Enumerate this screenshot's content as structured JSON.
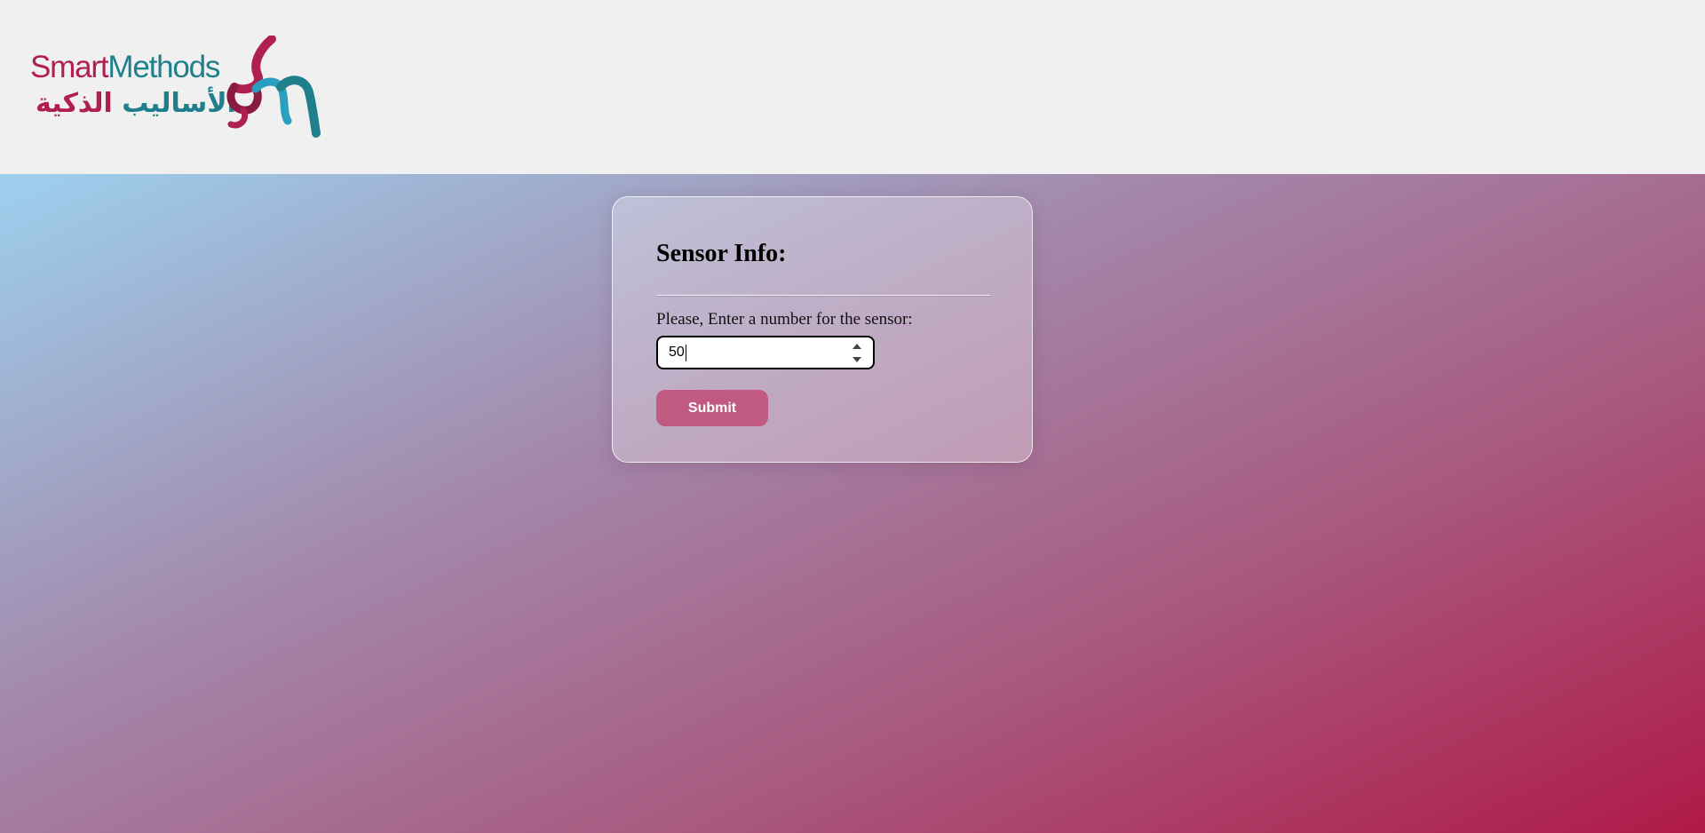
{
  "header": {
    "logo": {
      "name_en_part1": "Smart",
      "name_en_part2": "Methods",
      "name_ar_part1": "الأساليب",
      "name_ar_part2": "الذكية",
      "icon": "smart-methods-ribbon-logo"
    }
  },
  "form": {
    "title": "Sensor Info:",
    "prompt": "Please, Enter a number for the sensor:",
    "input_value": "50",
    "submit_label": "Submit"
  },
  "colors": {
    "header_background": "#f0f0f0",
    "gradient_start": "#9dd0ee",
    "gradient_end": "#b01a48",
    "submit_button": "#c05a80",
    "brand_teal": "#1f7f8c",
    "brand_magenta": "#b0204f"
  }
}
